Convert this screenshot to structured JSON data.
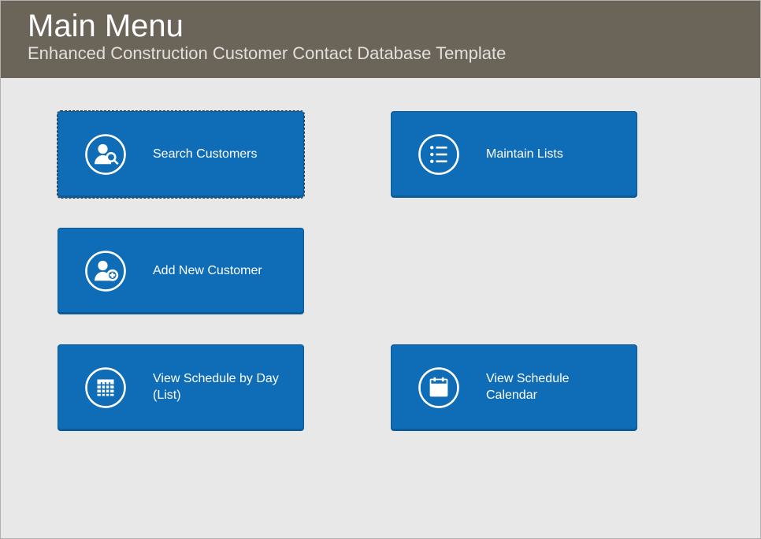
{
  "header": {
    "title": "Main Menu",
    "subtitle": "Enhanced Construction Customer Contact Database Template"
  },
  "tiles": {
    "search_customers": "Search Customers",
    "maintain_lists": "Maintain Lists",
    "add_new_customer": "Add New Customer",
    "view_schedule_list": "View Schedule by Day (List)",
    "view_schedule_calendar": "View Schedule Calendar"
  }
}
